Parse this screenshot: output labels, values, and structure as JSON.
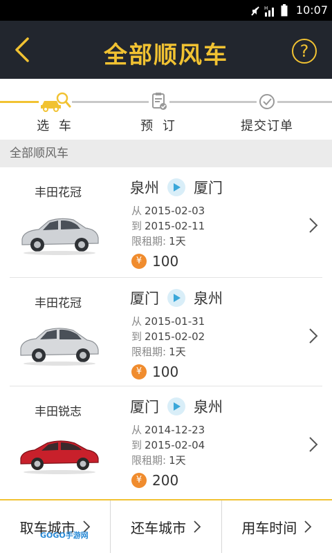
{
  "status_bar": {
    "time": "10:07"
  },
  "header": {
    "title": "全部顺风车",
    "help_label": "?"
  },
  "stepper": {
    "steps": [
      {
        "label": "选 车",
        "icon": "car-search-icon",
        "active": true
      },
      {
        "label": "预 订",
        "icon": "clipboard-check-icon",
        "active": false
      },
      {
        "label": "提交订单",
        "icon": "check-circle-icon",
        "active": false
      }
    ]
  },
  "section": {
    "title": "全部顺风车"
  },
  "labels": {
    "from": "从",
    "to": "到",
    "limit": "限租期:",
    "yen": "¥"
  },
  "listings": [
    {
      "car": "丰田花冠",
      "from_city": "泉州",
      "to_city": "厦门",
      "start_date": "2015-02-03",
      "end_date": "2015-02-11",
      "limit": "1天",
      "price": "100",
      "car_color": "#c9ccd1"
    },
    {
      "car": "丰田花冠",
      "from_city": "厦门",
      "to_city": "泉州",
      "start_date": "2015-01-31",
      "end_date": "2015-02-02",
      "limit": "1天",
      "price": "100",
      "car_color": "#d3d6da"
    },
    {
      "car": "丰田锐志",
      "from_city": "厦门",
      "to_city": "泉州",
      "start_date": "2014-12-23",
      "end_date": "2015-02-04",
      "limit": "1天",
      "price": "200",
      "car_color": "#c8202b"
    }
  ],
  "bottom_tabs": [
    {
      "label": "取车城市"
    },
    {
      "label": "还车城市"
    },
    {
      "label": "用车时间"
    }
  ],
  "watermark": "GOGO手游网",
  "colors": {
    "accent": "#f1c232",
    "header_bg": "#22262e",
    "price_icon": "#f08c2e",
    "route_arrow": "#3aa7d9"
  }
}
